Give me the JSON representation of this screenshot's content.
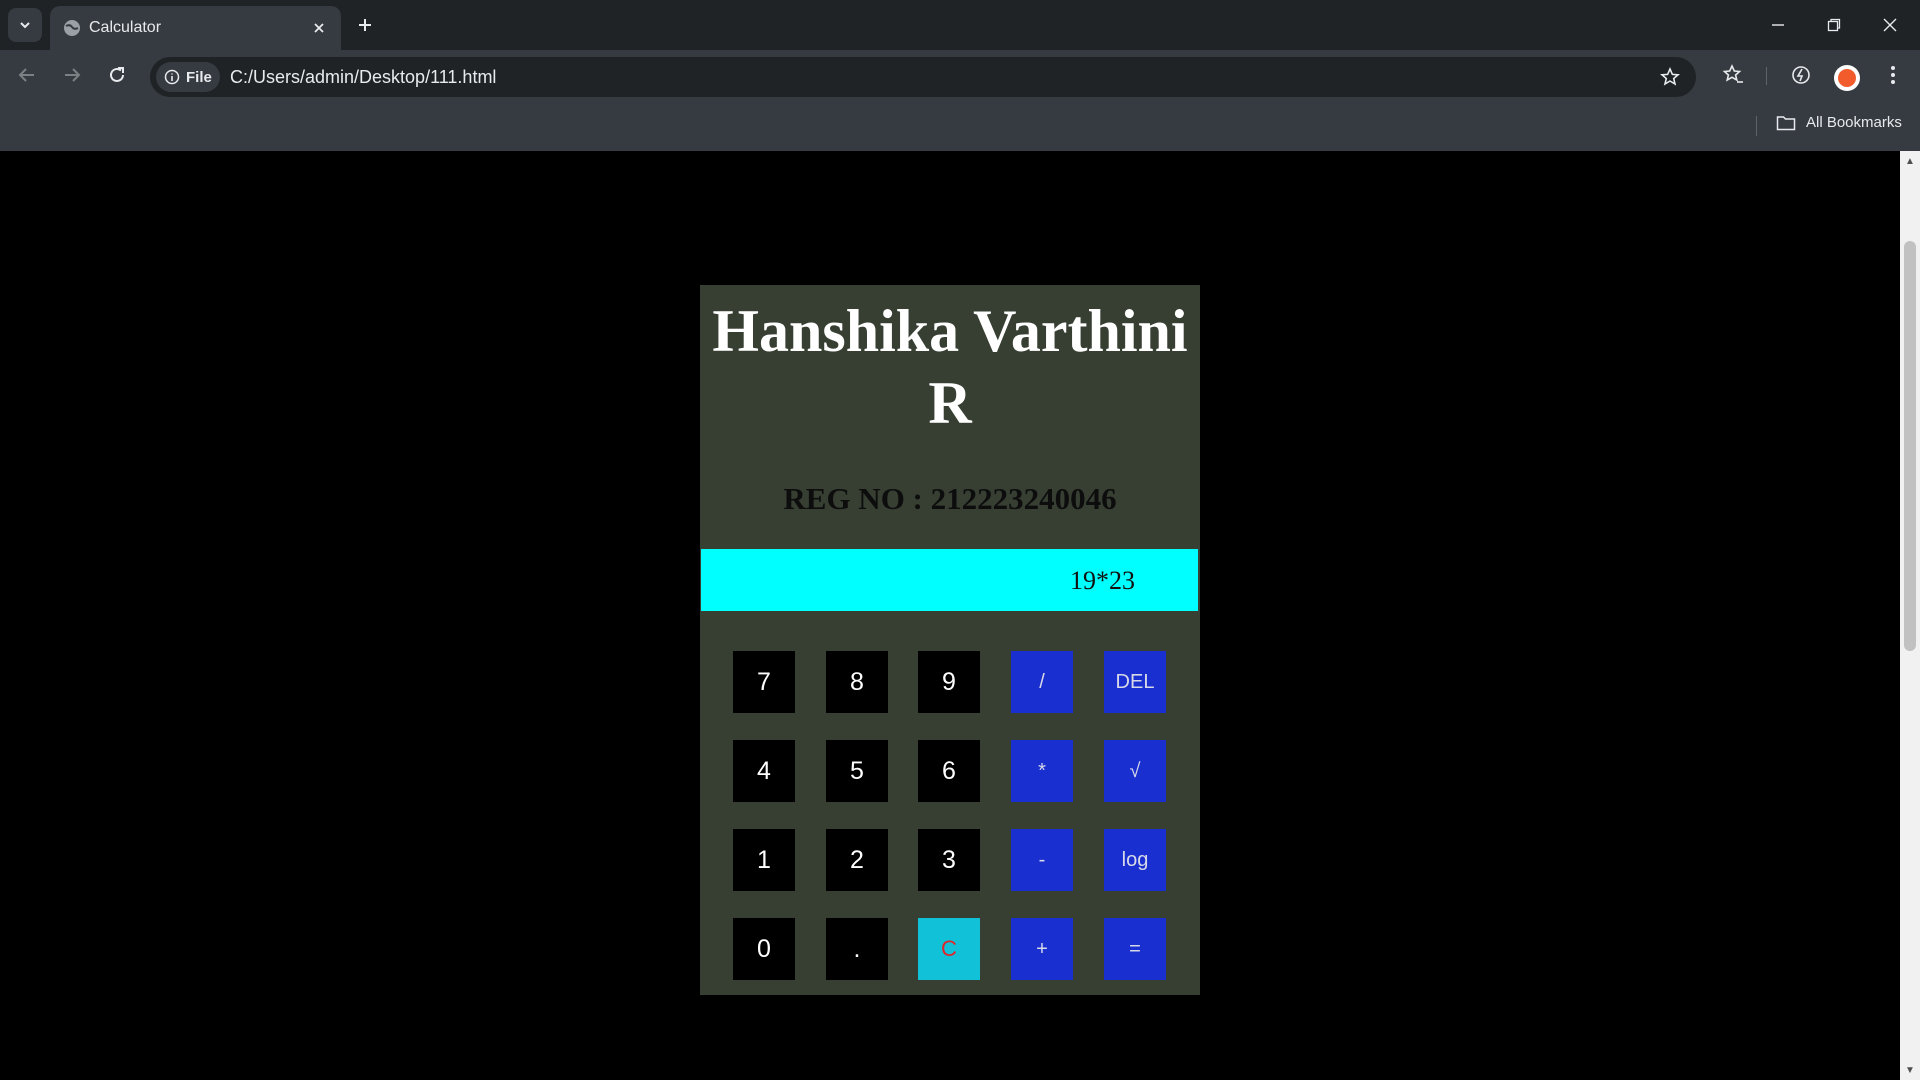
{
  "browser": {
    "tab_title": "Calculator",
    "site_chip_label": "File",
    "url": "C:/Users/admin/Desktop/111.html",
    "bookmarks_label": "All Bookmarks"
  },
  "page": {
    "name": "Hanshika Varthini R",
    "name_line1": "Hanshika Varthini",
    "name_line2": "R",
    "reg_no": "REG NO : 212223240046",
    "display_value": "19*23",
    "keys": [
      {
        "label": "7",
        "kind": "num"
      },
      {
        "label": "8",
        "kind": "num"
      },
      {
        "label": "9",
        "kind": "num"
      },
      {
        "label": "/",
        "kind": "op"
      },
      {
        "label": "DEL",
        "kind": "op"
      },
      {
        "label": "4",
        "kind": "num"
      },
      {
        "label": "5",
        "kind": "num"
      },
      {
        "label": "6",
        "kind": "num"
      },
      {
        "label": "*",
        "kind": "op"
      },
      {
        "label": "√",
        "kind": "op"
      },
      {
        "label": "1",
        "kind": "num"
      },
      {
        "label": "2",
        "kind": "num"
      },
      {
        "label": "3",
        "kind": "num"
      },
      {
        "label": "-",
        "kind": "op"
      },
      {
        "label": "log",
        "kind": "op"
      },
      {
        "label": "0",
        "kind": "num"
      },
      {
        "label": ".",
        "kind": "num"
      },
      {
        "label": "C",
        "kind": "clear"
      },
      {
        "label": "+",
        "kind": "op"
      },
      {
        "label": "=",
        "kind": "op"
      }
    ]
  },
  "colors": {
    "calculator_bg": "#373f33",
    "display_bg": "#00ffff",
    "number_key_bg": "#000000",
    "operator_key_bg": "#1a2fcf",
    "clear_key_bg": "#10c1d8",
    "clear_key_text": "#e0252a"
  }
}
